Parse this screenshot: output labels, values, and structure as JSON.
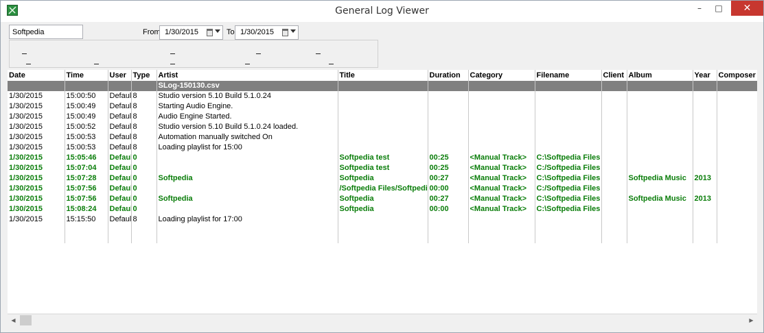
{
  "window": {
    "title": "General Log Viewer",
    "controls": {
      "minimize": "–",
      "maximize": "□",
      "close": "✕"
    }
  },
  "filters": {
    "search_value": "Softpedia",
    "from_label": "From",
    "from_date": "1/30/2015",
    "to_label": "To",
    "to_date": "1/30/2015"
  },
  "grid": {
    "columns": [
      "Date",
      "Time",
      "User",
      "Type",
      "Artist",
      "Title",
      "Duration",
      "Category",
      "Filename",
      "Client",
      "Album",
      "Year",
      "Composer"
    ],
    "section_title": "SLog-150130.csv",
    "rows": [
      {
        "style": "normal",
        "cells": [
          "1/30/2015",
          "15:00:50",
          "Default",
          "8",
          "Studio version 5.10 Build 5.1.0.24",
          "",
          "",
          "",
          "",
          "",
          "",
          "",
          ""
        ]
      },
      {
        "style": "normal",
        "cells": [
          "1/30/2015",
          "15:00:49",
          "Default",
          "8",
          "Starting Audio Engine.",
          "",
          "",
          "",
          "",
          "",
          "",
          "",
          ""
        ]
      },
      {
        "style": "normal",
        "cells": [
          "1/30/2015",
          "15:00:49",
          "Default",
          "8",
          "Audio Engine Started.",
          "",
          "",
          "",
          "",
          "",
          "",
          "",
          ""
        ]
      },
      {
        "style": "normal",
        "cells": [
          "1/30/2015",
          "15:00:52",
          "Default",
          "8",
          "Studio version 5.10 Build 5.1.0.24 loaded.",
          "",
          "",
          "",
          "",
          "",
          "",
          "",
          ""
        ]
      },
      {
        "style": "normal",
        "cells": [
          "1/30/2015",
          "15:00:53",
          "Default",
          "8",
          "Automation manually switched On",
          "",
          "",
          "",
          "",
          "",
          "",
          "",
          ""
        ]
      },
      {
        "style": "normal",
        "cells": [
          "1/30/2015",
          "15:00:53",
          "Default",
          "8",
          "Loading playlist for 15:00",
          "",
          "",
          "",
          "",
          "",
          "",
          "",
          ""
        ]
      },
      {
        "style": "green",
        "cells": [
          "1/30/2015",
          "15:05:46",
          "Default",
          "0",
          "",
          "Softpedia test",
          "00:25",
          "<Manual Track>",
          "C:\\Softpedia Files",
          "",
          "",
          "",
          ""
        ]
      },
      {
        "style": "green",
        "cells": [
          "1/30/2015",
          "15:07:04",
          "Default",
          "0",
          "",
          "Softpedia test",
          "00:25",
          "<Manual Track>",
          "C:/Softpedia Files",
          "",
          "",
          "",
          ""
        ]
      },
      {
        "style": "green",
        "cells": [
          "1/30/2015",
          "15:07:28",
          "Default",
          "0",
          "Softpedia",
          "Softpedia",
          "00:27",
          "<Manual Track>",
          "C:\\Softpedia Files",
          "",
          "Softpedia Music",
          "2013",
          ""
        ]
      },
      {
        "style": "green",
        "cells": [
          "1/30/2015",
          "15:07:56",
          "Default",
          "0",
          "",
          "/Softpedia Files/Softpedia",
          "00:00",
          "<Manual Track>",
          "C:/Softpedia Files",
          "",
          "",
          "",
          ""
        ]
      },
      {
        "style": "green",
        "cells": [
          "1/30/2015",
          "15:07:56",
          "Default",
          "0",
          "Softpedia",
          "Softpedia",
          "00:27",
          "<Manual Track>",
          "C:\\Softpedia Files",
          "",
          "Softpedia Music",
          "2013",
          ""
        ]
      },
      {
        "style": "green",
        "cells": [
          "1/30/2015",
          "15:08:24",
          "Default",
          "0",
          "",
          "Softpedia",
          "00:00",
          "<Manual Track>",
          "C:\\Softpedia Files",
          "",
          "",
          "",
          ""
        ]
      },
      {
        "style": "normal",
        "cells": [
          "1/30/2015",
          "15:15:50",
          "Default",
          "8",
          "Loading playlist for 17:00",
          "",
          "",
          "",
          "",
          "",
          "",
          "",
          ""
        ]
      }
    ]
  },
  "scrollbar": {
    "left_arrow": "◀",
    "right_arrow": "▶"
  }
}
